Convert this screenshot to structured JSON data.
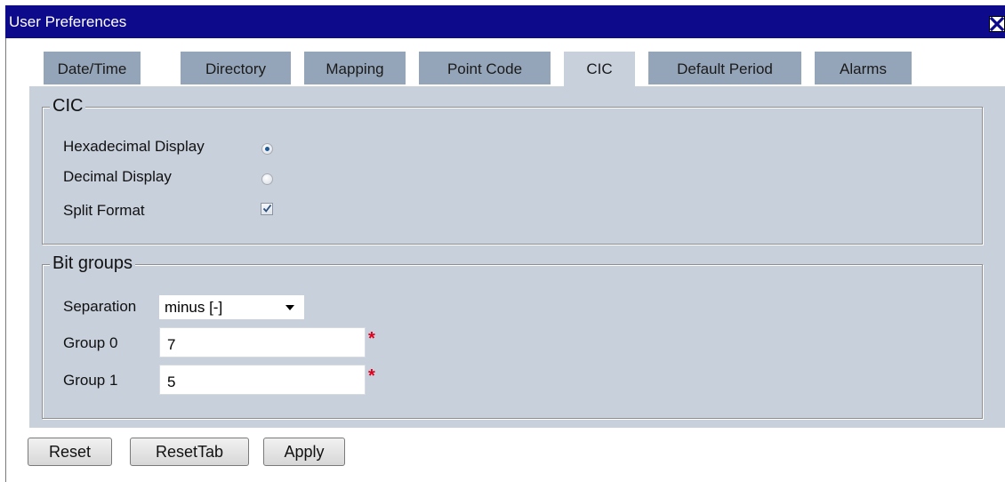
{
  "window": {
    "title": "User Preferences",
    "close_icon": "close-x-icon"
  },
  "tabs": [
    {
      "label": "Date/Time",
      "active": false
    },
    {
      "label": "Directory",
      "active": false
    },
    {
      "label": "Mapping",
      "active": false
    },
    {
      "label": "Point Code",
      "active": false
    },
    {
      "label": "CIC",
      "active": true
    },
    {
      "label": "Default Period",
      "active": false
    },
    {
      "label": "Alarms",
      "active": false
    }
  ],
  "cic": {
    "legend": "CIC",
    "hex_label": "Hexadecimal Display",
    "hex_selected": true,
    "decimal_label": "Decimal Display",
    "decimal_selected": false,
    "split_label": "Split Format",
    "split_checked": true
  },
  "bitgroups": {
    "legend": "Bit groups",
    "separation_label": "Separation",
    "separation_value": "minus [-]",
    "group0_label": "Group 0",
    "group0_value": "7",
    "group1_label": "Group 1",
    "group1_value": "5",
    "required_mark": "*"
  },
  "buttons": {
    "reset": "Reset",
    "reset_tab": "ResetTab",
    "apply": "Apply"
  },
  "colors": {
    "titlebar": "#0d0b8c",
    "tab_inactive": "#95a5b9",
    "panel": "#c8d0dc",
    "required": "#e0001b"
  }
}
